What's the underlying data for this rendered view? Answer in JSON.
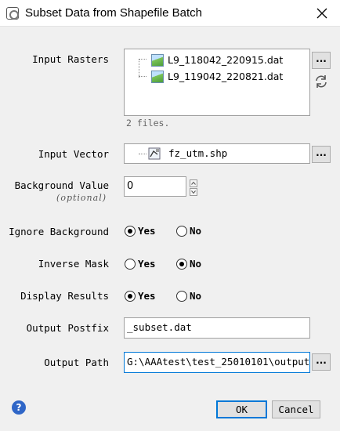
{
  "window": {
    "title": "Subset Data from Shapefile Batch"
  },
  "input_rasters": {
    "label": "Input Rasters",
    "files": [
      {
        "name": "L9_118042_220915.dat"
      },
      {
        "name": "L9_119042_220821.dat"
      }
    ],
    "count_note": "2 files.",
    "browse_label": "..."
  },
  "input_vector": {
    "label": "Input Vector",
    "file": "fz_utm.shp",
    "browse_label": "..."
  },
  "background_value": {
    "label": "Background Value",
    "sublabel": "(optional)",
    "value": "0"
  },
  "ignore_background": {
    "label": "Ignore Background",
    "options": [
      "Yes",
      "No"
    ],
    "selected": "Yes"
  },
  "inverse_mask": {
    "label": "Inverse Mask",
    "options": [
      "Yes",
      "No"
    ],
    "selected": "No"
  },
  "display_results": {
    "label": "Display Results",
    "options": [
      "Yes",
      "No"
    ],
    "selected": "Yes"
  },
  "output_postfix": {
    "label": "Output Postfix",
    "value": "_subset.dat"
  },
  "output_path": {
    "label": "Output Path",
    "value": "G:\\AAAtest\\test_25010101\\output",
    "browse_label": "..."
  },
  "footer": {
    "help_icon": "?",
    "ok_label": "OK",
    "cancel_label": "Cancel"
  }
}
